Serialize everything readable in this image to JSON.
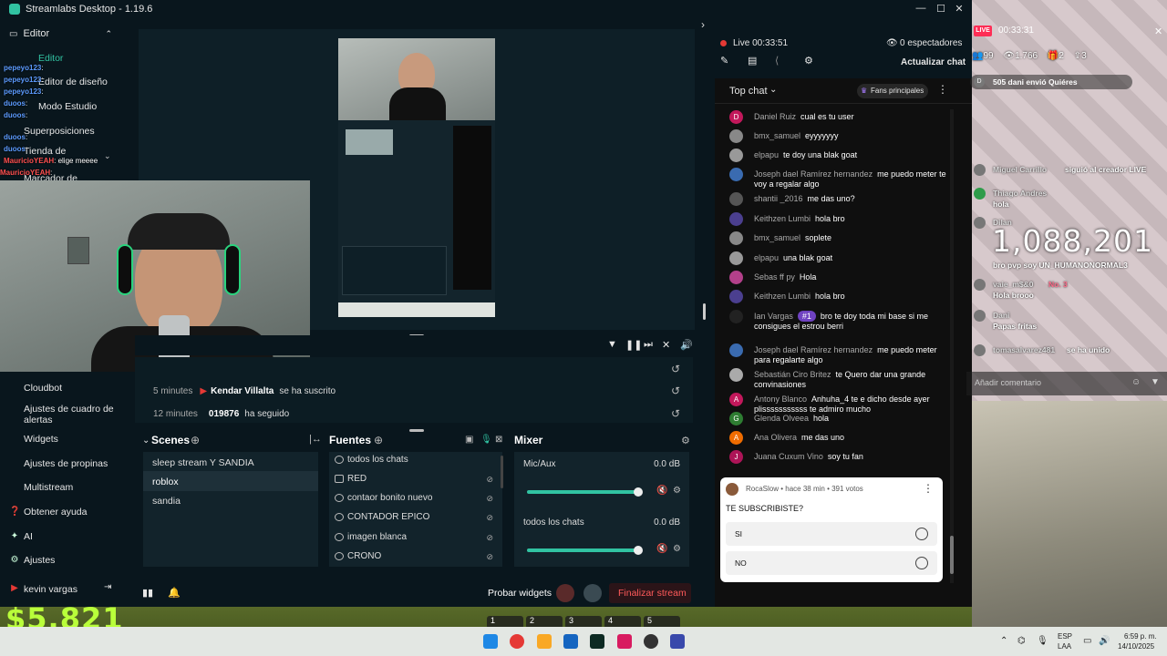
{
  "window": {
    "title": "Streamlabs Desktop - 1.19.6"
  },
  "sidebar": {
    "editor_header": "Editor",
    "items": [
      "Editor",
      "Editor de diseño",
      "Modo Estudio",
      "Superposiciones",
      "Tienda de",
      "Marcador de"
    ],
    "lower_items": [
      "Cloudbot",
      "Ajustes de cuadro de alertas",
      "Widgets",
      "Ajustes de propinas",
      "Multistream"
    ],
    "help": "Obtener ayuda",
    "ai": "AI",
    "settings": "Ajustes",
    "user": "kevin vargas"
  },
  "overlay_chat": [
    {
      "user": "pepeyo123",
      "text": ":"
    },
    {
      "user": "pepeyo123",
      "text": ":"
    },
    {
      "user": "pepeyo123",
      "text": ":"
    },
    {
      "user": "duoos",
      "text": ":"
    },
    {
      "user": "duoos",
      "text": ":"
    },
    {
      "user": "duoos",
      "text": ":"
    },
    {
      "user": "duoos",
      "text": ":"
    },
    {
      "user": "MauricioYEAH",
      "text": ": elige meeee"
    },
    {
      "user": "MauricioYEAH",
      "text": ":"
    }
  ],
  "events": [
    {
      "time": "5 minutes",
      "name": "Kendar Villalta",
      "action": "se ha suscrito"
    },
    {
      "time": "12 minutes",
      "name": "019876",
      "action": "ha seguido"
    }
  ],
  "scenes": {
    "title": "Scenes",
    "items": [
      "sleep stream Y SANDIA",
      "roblox",
      "sandia"
    ],
    "selected": "roblox"
  },
  "sources": {
    "title": "Fuentes",
    "items": [
      "todos los chats",
      "RED",
      "contaor bonito nuevo",
      "CONTADOR EPICO",
      "imagen blanca",
      "CRONO"
    ]
  },
  "mixer": {
    "title": "Mixer",
    "channels": [
      {
        "name": "Mic/Aux",
        "db": "0.0 dB",
        "level": 0.97
      },
      {
        "name": "todos los chats",
        "db": "0.0 dB",
        "level": 0.97
      }
    ]
  },
  "footer": {
    "test_widgets": "Probar widgets",
    "end_stream": "Finalizar stream"
  },
  "chat": {
    "live": "Live 00:33:51",
    "viewers": "0 espectadores",
    "refresh": "Actualizar chat",
    "mode": "Top chat",
    "fans": "Fans principales",
    "messages": [
      {
        "name": "Daniel Ruiz",
        "text": "cual es tu user",
        "color": "#c2185b",
        "initial": "D"
      },
      {
        "name": "bmx_samuel",
        "text": "eyyyyyyy",
        "color": "#888",
        "initial": ""
      },
      {
        "name": "elpapu",
        "text": "te doy una blak goat",
        "color": "#999",
        "initial": ""
      },
      {
        "name": "Joseph dael Ramírez hernandez",
        "text": "me puedo meter te voy a regalar algo",
        "color": "#3a6bb0",
        "initial": ""
      },
      {
        "name": "shantii _2016",
        "text": "me das uno?",
        "color": "#555",
        "initial": ""
      },
      {
        "name": "Keithzen Lumbi",
        "text": "hola bro",
        "color": "#4b3f8f",
        "initial": ""
      },
      {
        "name": "bmx_samuel",
        "text": "soplete",
        "color": "#888",
        "initial": ""
      },
      {
        "name": "elpapu",
        "text": "una blak goat",
        "color": "#999",
        "initial": ""
      },
      {
        "name": "Sebas ff py",
        "text": "Hola",
        "color": "#b3408a",
        "initial": ""
      },
      {
        "name": "Keithzen Lumbi",
        "text": "hola bro",
        "color": "#4b3f8f",
        "initial": ""
      },
      {
        "name": "Ian Vargas",
        "badge": "#1",
        "text": "bro te doy toda mi base si me consigues el estrou berri",
        "color": "#222",
        "initial": ""
      },
      {
        "name": "Joseph dael Ramírez hernandez",
        "text": "me puedo meter para regalarte algo",
        "color": "#3a6bb0",
        "initial": ""
      },
      {
        "name": "Sebastián Ciro Britez",
        "text": "te Quero dar una grande convinasiones",
        "color": "#aaa",
        "initial": ""
      },
      {
        "name": "Antony Blanco",
        "text": "Anhuha_4 te e dicho desde ayer plisssssssssss te admiro mucho",
        "color": "#c2185b",
        "initial": "A"
      },
      {
        "name": "Glenda Olveea",
        "text": "hola",
        "color": "#2e7d32",
        "initial": "G"
      },
      {
        "name": "Ana Olivera",
        "text": "me das uno",
        "color": "#ef6c00",
        "initial": "A"
      },
      {
        "name": "Juana Cuxum Vino",
        "text": "soy tu fan",
        "color": "#ad1457",
        "initial": "J"
      }
    ]
  },
  "poll": {
    "meta": "RocaSlow • hace 38 min • 391 votos",
    "question": "TE SUBSCRIBISTE?",
    "options": [
      "SI",
      "NO"
    ]
  },
  "tiktok": {
    "live_time": "00:33:31",
    "stats": [
      "99",
      "1.766",
      "2",
      "3"
    ],
    "notice": "505 dani envió Quiéres",
    "big_counter": "1,088,201",
    "comments": [
      {
        "user": "Miguel Carrillo",
        "text": "siguió al creador LIVE"
      },
      {
        "user": "Thiago Andres",
        "text": "hola"
      },
      {
        "user": "Dilan",
        "text": "bro pvp soy UN_HUMANONORMAL3"
      },
      {
        "user": "vaie_m$&0",
        "text": "Hola brooo",
        "badge": "No. 3"
      },
      {
        "user": "Dani",
        "text": "Papas fritas"
      },
      {
        "user": "tomasalvarez481",
        "text": "se ha unido"
      }
    ],
    "add_comment": "Añadir comentario"
  },
  "game": {
    "money": "$5,821"
  },
  "taskbar": {
    "lang": "ESP",
    "lang2": "LAA",
    "time": "6:59 p. m.",
    "date": "14/10/2025",
    "hotbar": [
      "1",
      "2",
      "3",
      "4",
      "5"
    ]
  }
}
